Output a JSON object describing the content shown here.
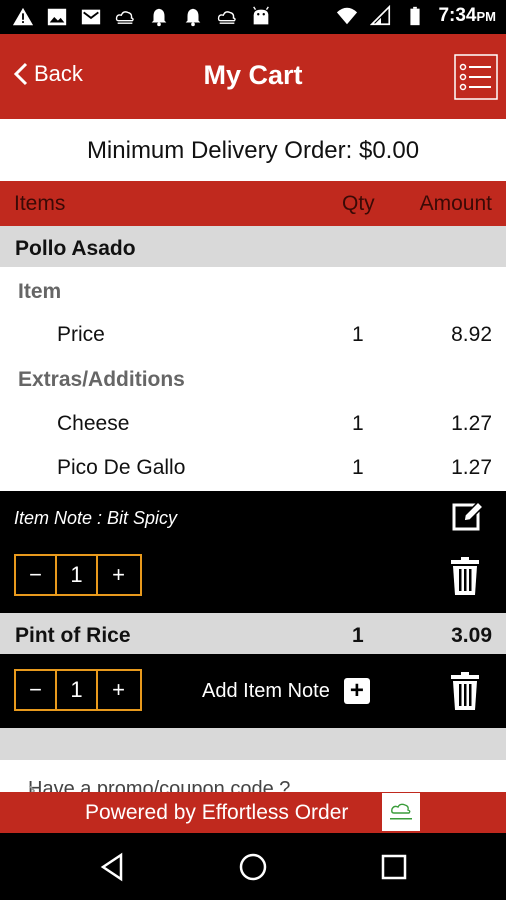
{
  "status_bar": {
    "time": "7:34",
    "ampm": "PM"
  },
  "header": {
    "back_label": "Back",
    "title": "My Cart"
  },
  "min_order": "Minimum Delivery Order: $0.00",
  "columns": {
    "items": "Items",
    "qty": "Qty",
    "amount": "Amount"
  },
  "cart": [
    {
      "name": "Pollo Asado",
      "item_label": "Item",
      "item_rows": [
        {
          "name": "Price",
          "qty": "1",
          "amount": "8.92"
        }
      ],
      "extras_label": "Extras/Additions",
      "extras": [
        {
          "name": "Cheese",
          "qty": "1",
          "amount": "1.27"
        },
        {
          "name": "Pico De Gallo",
          "qty": "1",
          "amount": "1.27"
        }
      ],
      "note": "Item Note : Bit Spicy",
      "stepper": {
        "minus": "−",
        "value": "1",
        "plus": "+"
      }
    },
    {
      "name": "Pint of Rice",
      "qty": "1",
      "amount": "3.09",
      "add_note_label": "Add Item Note",
      "add_note_icon": "+",
      "stepper": {
        "minus": "−",
        "value": "1",
        "plus": "+"
      }
    }
  ],
  "promo": {
    "text": "Have a promo/coupon code ?",
    "chevron": "›"
  },
  "footer": {
    "powered_by": "Powered by Effortless Order"
  },
  "colors": {
    "brand_red": "#c0291e",
    "stepper_orange": "#e89a1d"
  }
}
